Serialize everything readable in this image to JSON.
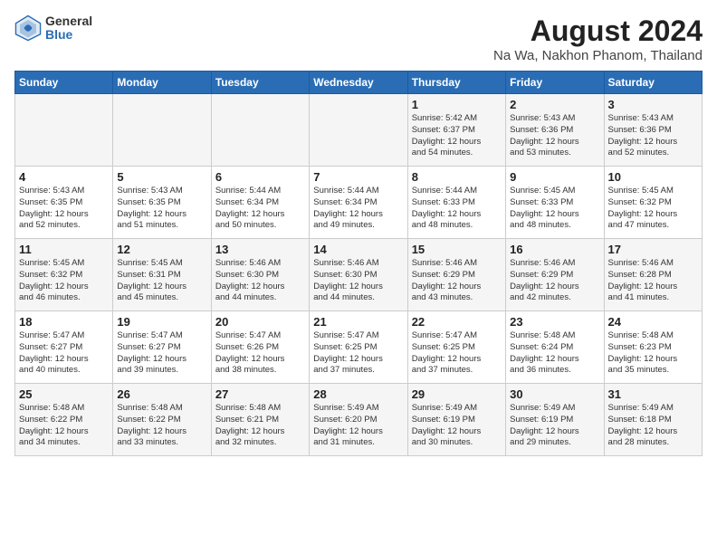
{
  "logo": {
    "general": "General",
    "blue": "Blue"
  },
  "title": "August 2024",
  "subtitle": "Na Wa, Nakhon Phanom, Thailand",
  "days_of_week": [
    "Sunday",
    "Monday",
    "Tuesday",
    "Wednesday",
    "Thursday",
    "Friday",
    "Saturday"
  ],
  "weeks": [
    [
      {
        "day": "",
        "content": ""
      },
      {
        "day": "",
        "content": ""
      },
      {
        "day": "",
        "content": ""
      },
      {
        "day": "",
        "content": ""
      },
      {
        "day": "1",
        "content": "Sunrise: 5:42 AM\nSunset: 6:37 PM\nDaylight: 12 hours\nand 54 minutes."
      },
      {
        "day": "2",
        "content": "Sunrise: 5:43 AM\nSunset: 6:36 PM\nDaylight: 12 hours\nand 53 minutes."
      },
      {
        "day": "3",
        "content": "Sunrise: 5:43 AM\nSunset: 6:36 PM\nDaylight: 12 hours\nand 52 minutes."
      }
    ],
    [
      {
        "day": "4",
        "content": "Sunrise: 5:43 AM\nSunset: 6:35 PM\nDaylight: 12 hours\nand 52 minutes."
      },
      {
        "day": "5",
        "content": "Sunrise: 5:43 AM\nSunset: 6:35 PM\nDaylight: 12 hours\nand 51 minutes."
      },
      {
        "day": "6",
        "content": "Sunrise: 5:44 AM\nSunset: 6:34 PM\nDaylight: 12 hours\nand 50 minutes."
      },
      {
        "day": "7",
        "content": "Sunrise: 5:44 AM\nSunset: 6:34 PM\nDaylight: 12 hours\nand 49 minutes."
      },
      {
        "day": "8",
        "content": "Sunrise: 5:44 AM\nSunset: 6:33 PM\nDaylight: 12 hours\nand 48 minutes."
      },
      {
        "day": "9",
        "content": "Sunrise: 5:45 AM\nSunset: 6:33 PM\nDaylight: 12 hours\nand 48 minutes."
      },
      {
        "day": "10",
        "content": "Sunrise: 5:45 AM\nSunset: 6:32 PM\nDaylight: 12 hours\nand 47 minutes."
      }
    ],
    [
      {
        "day": "11",
        "content": "Sunrise: 5:45 AM\nSunset: 6:32 PM\nDaylight: 12 hours\nand 46 minutes."
      },
      {
        "day": "12",
        "content": "Sunrise: 5:45 AM\nSunset: 6:31 PM\nDaylight: 12 hours\nand 45 minutes."
      },
      {
        "day": "13",
        "content": "Sunrise: 5:46 AM\nSunset: 6:30 PM\nDaylight: 12 hours\nand 44 minutes."
      },
      {
        "day": "14",
        "content": "Sunrise: 5:46 AM\nSunset: 6:30 PM\nDaylight: 12 hours\nand 44 minutes."
      },
      {
        "day": "15",
        "content": "Sunrise: 5:46 AM\nSunset: 6:29 PM\nDaylight: 12 hours\nand 43 minutes."
      },
      {
        "day": "16",
        "content": "Sunrise: 5:46 AM\nSunset: 6:29 PM\nDaylight: 12 hours\nand 42 minutes."
      },
      {
        "day": "17",
        "content": "Sunrise: 5:46 AM\nSunset: 6:28 PM\nDaylight: 12 hours\nand 41 minutes."
      }
    ],
    [
      {
        "day": "18",
        "content": "Sunrise: 5:47 AM\nSunset: 6:27 PM\nDaylight: 12 hours\nand 40 minutes."
      },
      {
        "day": "19",
        "content": "Sunrise: 5:47 AM\nSunset: 6:27 PM\nDaylight: 12 hours\nand 39 minutes."
      },
      {
        "day": "20",
        "content": "Sunrise: 5:47 AM\nSunset: 6:26 PM\nDaylight: 12 hours\nand 38 minutes."
      },
      {
        "day": "21",
        "content": "Sunrise: 5:47 AM\nSunset: 6:25 PM\nDaylight: 12 hours\nand 37 minutes."
      },
      {
        "day": "22",
        "content": "Sunrise: 5:47 AM\nSunset: 6:25 PM\nDaylight: 12 hours\nand 37 minutes."
      },
      {
        "day": "23",
        "content": "Sunrise: 5:48 AM\nSunset: 6:24 PM\nDaylight: 12 hours\nand 36 minutes."
      },
      {
        "day": "24",
        "content": "Sunrise: 5:48 AM\nSunset: 6:23 PM\nDaylight: 12 hours\nand 35 minutes."
      }
    ],
    [
      {
        "day": "25",
        "content": "Sunrise: 5:48 AM\nSunset: 6:22 PM\nDaylight: 12 hours\nand 34 minutes."
      },
      {
        "day": "26",
        "content": "Sunrise: 5:48 AM\nSunset: 6:22 PM\nDaylight: 12 hours\nand 33 minutes."
      },
      {
        "day": "27",
        "content": "Sunrise: 5:48 AM\nSunset: 6:21 PM\nDaylight: 12 hours\nand 32 minutes."
      },
      {
        "day": "28",
        "content": "Sunrise: 5:49 AM\nSunset: 6:20 PM\nDaylight: 12 hours\nand 31 minutes."
      },
      {
        "day": "29",
        "content": "Sunrise: 5:49 AM\nSunset: 6:19 PM\nDaylight: 12 hours\nand 30 minutes."
      },
      {
        "day": "30",
        "content": "Sunrise: 5:49 AM\nSunset: 6:19 PM\nDaylight: 12 hours\nand 29 minutes."
      },
      {
        "day": "31",
        "content": "Sunrise: 5:49 AM\nSunset: 6:18 PM\nDaylight: 12 hours\nand 28 minutes."
      }
    ]
  ]
}
